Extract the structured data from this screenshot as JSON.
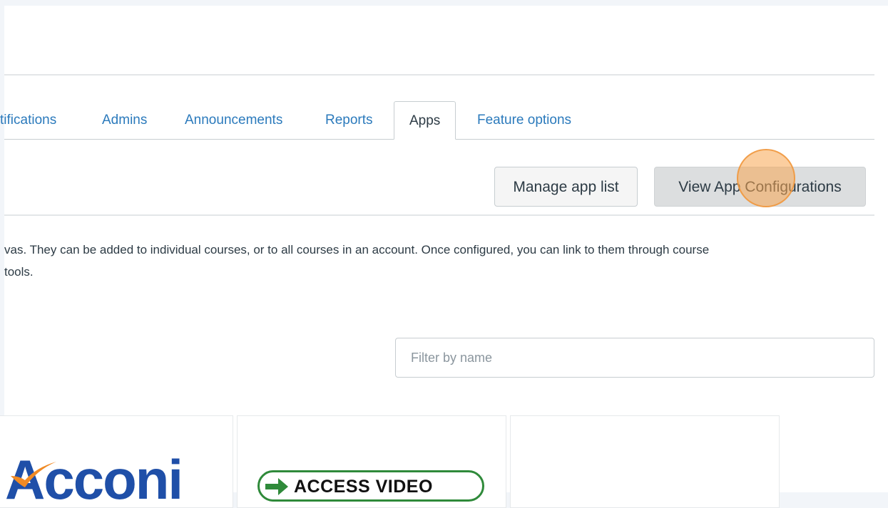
{
  "tabs": [
    {
      "label": "tifications",
      "active": false
    },
    {
      "label": "Admins",
      "active": false
    },
    {
      "label": "Announcements",
      "active": false
    },
    {
      "label": "Reports",
      "active": false
    },
    {
      "label": "Apps",
      "active": true
    },
    {
      "label": "Feature options",
      "active": false
    }
  ],
  "toolbar": {
    "manage_label": "Manage app list",
    "view_label": "View App Configurations"
  },
  "description": {
    "line1": "vas. They can be added to individual courses, or to all courses in an account. Once configured, you can link to them through course",
    "line2": "tools."
  },
  "filter": {
    "placeholder": "Filter by name",
    "value": ""
  },
  "apps": [
    {
      "logo_text": "Acconi"
    },
    {
      "logo_text": "ACCESS VIDEO"
    },
    {
      "logo_text": ""
    }
  ],
  "colors": {
    "link": "#2b7abc",
    "text": "#2d3b45",
    "border": "#c7cdd1",
    "click_marker": "#f7a650"
  },
  "icons": {
    "acconi_swoosh": "orange-check-swoosh",
    "access_arrow": "green-right-arrow"
  }
}
